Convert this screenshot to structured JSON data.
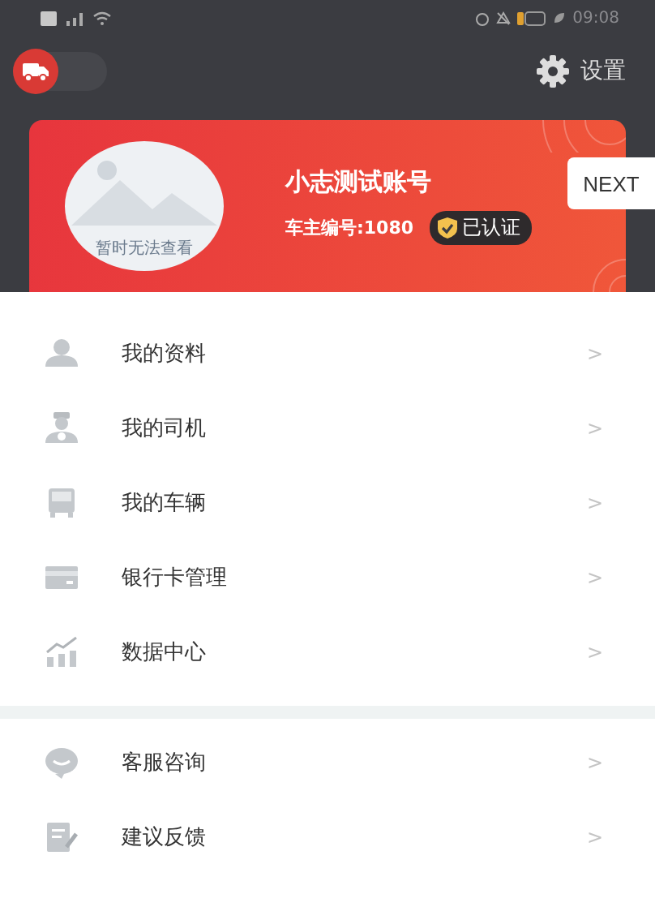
{
  "status_bar": {
    "time": "09:08"
  },
  "header": {
    "mode_switch": {
      "on": false
    },
    "settings": {
      "label": "设置"
    }
  },
  "profile": {
    "avatar_caption": "暂时无法查看",
    "name": "小志测试账号",
    "owner_id": "车主编号:1080",
    "badge": "已认证"
  },
  "next_button": {
    "label": "NEXT"
  },
  "menu_groups": [
    {
      "items": [
        {
          "kind": "person",
          "label": "我的资料",
          "chevron": ">"
        },
        {
          "kind": "driver",
          "label": "我的司机",
          "chevron": ">"
        },
        {
          "kind": "vehicle",
          "label": "我的车辆",
          "chevron": ">"
        },
        {
          "kind": "card",
          "label": "银行卡管理",
          "chevron": ">"
        },
        {
          "kind": "chart",
          "label": "数据中心",
          "chevron": ">"
        }
      ]
    },
    {
      "items": [
        {
          "kind": "chat",
          "label": "客服咨询",
          "chevron": ">"
        },
        {
          "kind": "feedback",
          "label": "建议反馈",
          "chevron": ">"
        }
      ]
    }
  ]
}
